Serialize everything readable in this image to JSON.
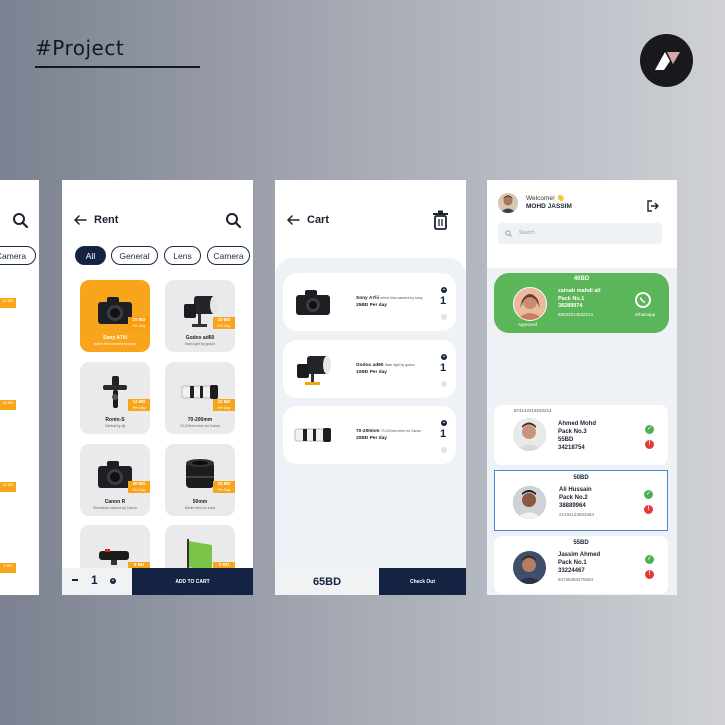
{
  "brand": {
    "title": "#Project"
  },
  "rent": {
    "title": "Rent",
    "chips": [
      "All",
      "General",
      "Lens",
      "Camera"
    ],
    "products": [
      {
        "name": "Sony A7iii",
        "desc": "mirror less camera by sony",
        "price": "25 BD",
        "per": "Per Day"
      },
      {
        "name": "Godox ad60",
        "desc": "flash light by godox",
        "price": "10 BD",
        "per": "Per Day"
      },
      {
        "name": "Ronin-S",
        "desc": "Gimbal by dji",
        "price": "12 BD",
        "per": "Per Day"
      },
      {
        "name": "70-200mm",
        "desc": "70-200mm lens for Canon",
        "price": "20 BD",
        "per": "Per Day"
      },
      {
        "name": "Canon R",
        "desc": "Mirrorless camera by Canon",
        "price": "20 BD",
        "per": "Per Day"
      },
      {
        "name": "50mm",
        "desc": "50mm lens for sony",
        "price": "15 BD",
        "per": "Per Day"
      },
      {
        "name": "",
        "desc": "",
        "price": "5 BD",
        "per": "Per Day"
      },
      {
        "name": "",
        "desc": "",
        "price": "5 BD",
        "per": "Per Day"
      }
    ],
    "edge_tags": [
      "10 BD",
      "20 BD",
      "15 BD",
      "5 BD"
    ],
    "edge_chip": "Camera",
    "quantity": "1",
    "add_to_cart": "ADD TO CART"
  },
  "cart": {
    "title": "Cart",
    "items": [
      {
        "name": "Sony A7iii",
        "desc": "mirror less camera by sony",
        "price": "25BD Per day",
        "qty": "1"
      },
      {
        "name": "Godox ad60",
        "desc": "flash light by godox",
        "price": "10BD Per day",
        "qty": "1"
      },
      {
        "name": "70-200mm",
        "desc": "70-200mm lens for Canon",
        "price": "20BD Per day",
        "qty": "1"
      }
    ],
    "total": "65BD",
    "checkout": "Check Out"
  },
  "admin": {
    "welcome": "Welcome! 👋",
    "user_name": "MOHD JASSIM",
    "search_placeholder": "Search",
    "highlight": {
      "amount": "40BD",
      "name": "zainab mahdi ali",
      "pack": "Pack No.1",
      "phone": "38289974",
      "id": "65533214632214",
      "status": "Approved",
      "action": "Whatsapp"
    },
    "orders": [
      {
        "header": "874142214632214",
        "name": "Ahmed Mohd",
        "pack": "Pack No.3",
        "amount": "55BD",
        "phone": "34218754",
        "id": ""
      },
      {
        "header": "50BD",
        "name": "Ali Hussain",
        "pack": "Pack No.2",
        "amount": "",
        "phone": "38889964",
        "id": "21234124533464"
      },
      {
        "header": "55BD",
        "name": "Jassim Ahmed",
        "pack": "Pack No.1",
        "amount": "",
        "phone": "33224467",
        "id": "94736383475654"
      }
    ]
  }
}
